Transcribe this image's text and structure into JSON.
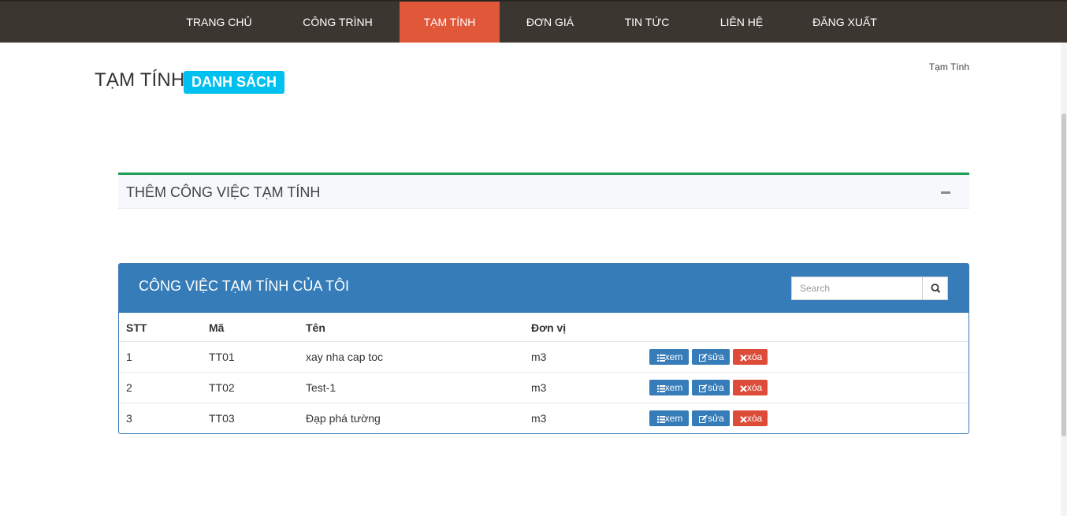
{
  "nav": {
    "items": [
      {
        "label": "TRANG CHỦ"
      },
      {
        "label": "CÔNG TRÌNH"
      },
      {
        "label": "TẠM TÍNH"
      },
      {
        "label": "ĐƠN GIÁ"
      },
      {
        "label": "TIN TỨC"
      },
      {
        "label": "LIÊN HỆ"
      },
      {
        "label": "ĐĂNG XUẤT"
      }
    ],
    "active": "TẠM TÍNH",
    "colors": {
      "bar": "#3c3631",
      "active": "#e1573a"
    }
  },
  "header": {
    "title": "TẠM TÍNH",
    "badge": "DANH SÁCH",
    "breadcrumb": "Tạm Tính"
  },
  "add_box": {
    "title": "THÊM CÔNG VIỆC TẠM TÍNH",
    "collapse_icon": "minus-icon"
  },
  "list_box": {
    "title": "CÔNG VIỆC TẠM TÍNH CỦA TÔI",
    "search_placeholder": "Search",
    "search_icon": "search-icon",
    "columns": [
      "STT",
      "Mã",
      "Tên",
      "Đơn vị"
    ],
    "rows": [
      {
        "stt": "1",
        "ma": "TT01",
        "ten": "xay nha cap toc",
        "don_vi": "m3"
      },
      {
        "stt": "2",
        "ma": "TT02",
        "ten": "Test-1",
        "don_vi": "m3"
      },
      {
        "stt": "3",
        "ma": "TT03",
        "ten": "Đạp phá tường",
        "don_vi": "m3"
      }
    ],
    "actions": {
      "view": "xem",
      "edit": "sửa",
      "delete": "xóa"
    },
    "colors": {
      "header": "#357cb8",
      "delete": "#dd4b39"
    }
  }
}
